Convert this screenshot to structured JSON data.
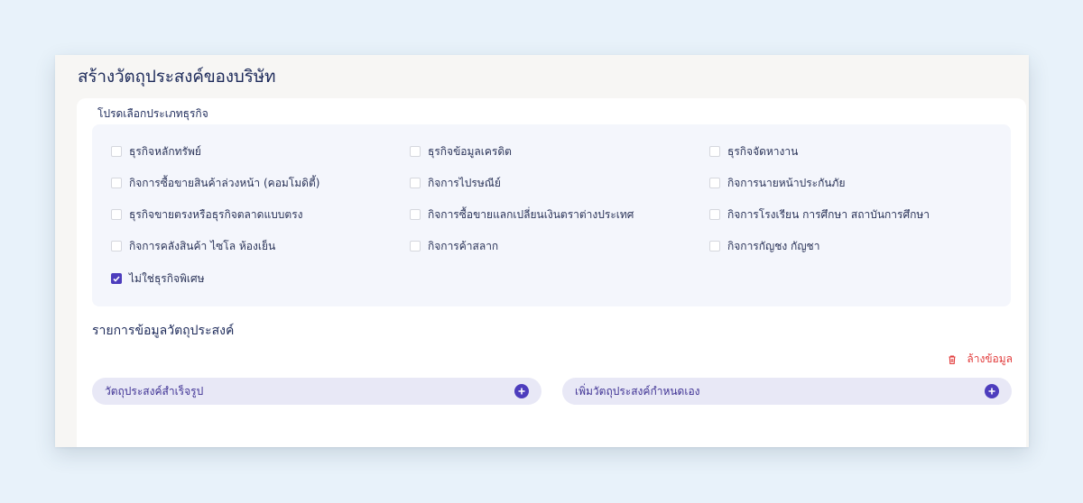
{
  "page": {
    "title": "สร้างวัตถุประสงค์ของบริษัท"
  },
  "business_type": {
    "label": "โปรดเลือกประเภทธุรกิจ",
    "items": [
      {
        "label": "ธุรกิจหลักทรัพย์",
        "checked": false
      },
      {
        "label": "ธุรกิจข้อมูลเครดิต",
        "checked": false
      },
      {
        "label": "ธุรกิจจัดหางาน",
        "checked": false
      },
      {
        "label": "กิจการซื้อขายสินค้าล่วงหน้า (คอมโมดิตี้)",
        "checked": false
      },
      {
        "label": "กิจการไปรษณีย์",
        "checked": false
      },
      {
        "label": "กิจการนายหน้าประกันภัย",
        "checked": false
      },
      {
        "label": "ธุรกิจขายตรงหรือธุรกิจตลาดแบบตรง",
        "checked": false
      },
      {
        "label": "กิจการซื้อขายแลกเปลี่ยนเงินตราต่างประเทศ",
        "checked": false
      },
      {
        "label": "กิจการโรงเรียน การศึกษา สถาบันการศึกษา",
        "checked": false
      },
      {
        "label": "กิจการคลังสินค้า ไซโล ห้องเย็น",
        "checked": false
      },
      {
        "label": "กิจการค้าสลาก",
        "checked": false
      },
      {
        "label": "กิจการกัญชง กัญชา",
        "checked": false
      },
      {
        "label": "ไม่ใช่ธุรกิจพิเศษ",
        "checked": true
      }
    ]
  },
  "objectives": {
    "title": "รายการข้อมูลวัตถุประสงค์",
    "clear_label": "ล้างข้อมูล",
    "ready_made_label": "วัตถุประสงค์สำเร็จรูป",
    "custom_label": "เพิ่มวัตถุประสงค์กำหนดเอง"
  },
  "icons": {
    "clear": "trash-icon",
    "add": "plus-circle-icon",
    "check": "check-icon"
  },
  "colors": {
    "accent": "#4d3dbd",
    "danger": "#e23c3c",
    "pill_bg": "#e8e8f6",
    "panel_bg": "#f4f6fc"
  }
}
